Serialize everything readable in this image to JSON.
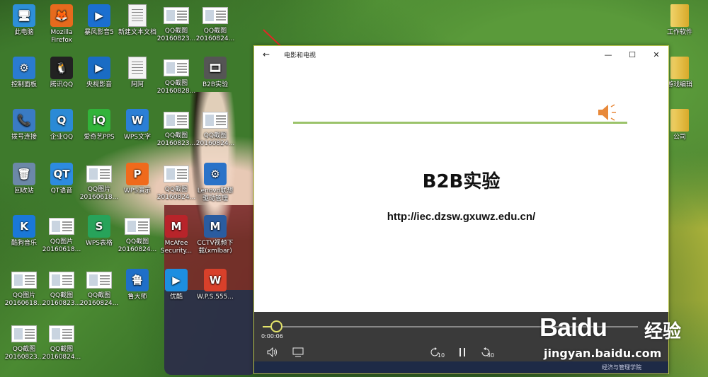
{
  "desktop": {
    "icons": [
      {
        "label": "此电脑",
        "kind": "ico",
        "color": "#2d8fd8",
        "glyph": "🖥"
      },
      {
        "label": "Mozilla Firefox",
        "kind": "ico",
        "color": "#e66a1d",
        "glyph": "🦊"
      },
      {
        "label": "暴风影音5",
        "kind": "ico",
        "color": "#1b6fd0",
        "glyph": "▶"
      },
      {
        "label": "新建文本文档",
        "kind": "doc"
      },
      {
        "label": "QQ截图 20160823...",
        "kind": "thumb"
      },
      {
        "label": "QQ截图 20160824...",
        "kind": "thumb"
      },
      {
        "label": "控制面板",
        "kind": "ico",
        "color": "#2a7bd0",
        "glyph": "⚙"
      },
      {
        "label": "腾讯QQ",
        "kind": "ico",
        "color": "#222222",
        "glyph": "🐧"
      },
      {
        "label": "央视影音",
        "kind": "ico",
        "color": "#1a6cc4",
        "glyph": "▶"
      },
      {
        "label": "阿阿",
        "kind": "doc"
      },
      {
        "label": "QQ截图 20160828...",
        "kind": "thumb"
      },
      {
        "label": "B2B实验",
        "kind": "ico",
        "color": "#555555",
        "glyph": "🎞"
      },
      {
        "label": "拨号连接",
        "kind": "ico",
        "color": "#3a7bc4",
        "glyph": "📞"
      },
      {
        "label": "企业QQ",
        "kind": "ico",
        "color": "#2b8ad6",
        "glyph": "Q"
      },
      {
        "label": "爱奇艺PPS",
        "kind": "ico",
        "color": "#32b33a",
        "glyph": "iQ"
      },
      {
        "label": "WPS文字",
        "kind": "ico",
        "color": "#2b7fd6",
        "glyph": "W"
      },
      {
        "label": "QQ截图 20160823...",
        "kind": "thumb"
      },
      {
        "label": "QQ截图 20160824...",
        "kind": "thumb"
      },
      {
        "label": "回收站",
        "kind": "ico",
        "color": "#6c88a8",
        "glyph": "🗑"
      },
      {
        "label": "QT语音",
        "kind": "ico",
        "color": "#2d8be0",
        "glyph": "QT"
      },
      {
        "label": "QQ图片 20160618...",
        "kind": "thumb"
      },
      {
        "label": "WPS演示",
        "kind": "ico",
        "color": "#f06a1c",
        "glyph": "P"
      },
      {
        "label": "QQ截图 20160824...",
        "kind": "thumb"
      },
      {
        "label": "Lenovo联想驱动管理",
        "kind": "ico",
        "color": "#2a72c8",
        "glyph": "⚙"
      },
      {
        "label": "酷狗音乐",
        "kind": "ico",
        "color": "#1a78d8",
        "glyph": "K"
      },
      {
        "label": "QQ图片 20160618...",
        "kind": "thumb"
      },
      {
        "label": "WPS表格",
        "kind": "ico",
        "color": "#27a35a",
        "glyph": "S"
      },
      {
        "label": "QQ截图 20160824...",
        "kind": "thumb"
      },
      {
        "label": "McAfee Security...",
        "kind": "ico",
        "color": "#b8242a",
        "glyph": "M"
      },
      {
        "label": "CCTV视频下载(xmlbar)",
        "kind": "ico",
        "color": "#2a5ca0",
        "glyph": "M"
      },
      {
        "label": "QQ图片 20160618...",
        "kind": "thumb"
      },
      {
        "label": "QQ截图 20160823...",
        "kind": "thumb"
      },
      {
        "label": "QQ截图 20160824...",
        "kind": "thumb"
      },
      {
        "label": "鲁大师",
        "kind": "ico",
        "color": "#1f6fc8",
        "glyph": "鲁"
      },
      {
        "label": "优酷",
        "kind": "ico",
        "color": "#1d8ee0",
        "glyph": "▶"
      },
      {
        "label": "W.P.S.555...",
        "kind": "ico",
        "color": "#d8402a",
        "glyph": "W"
      },
      {
        "label": "QQ截图 20160823...",
        "kind": "thumb"
      },
      {
        "label": "QQ截图 20160824...",
        "kind": "thumb"
      },
      {
        "label": "工作软件",
        "kind": "folder"
      },
      {
        "label": "游戏编辑",
        "kind": "folder"
      },
      {
        "label": "公司",
        "kind": "folder"
      }
    ]
  },
  "window": {
    "title": "电影和电视",
    "back_icon": "←",
    "minimize_icon": "—",
    "maximize_icon": "☐",
    "close_icon": "✕"
  },
  "slide": {
    "title": "B2B实验",
    "url": "http://iec.dzsw.gxuwz.edu.cn/"
  },
  "player": {
    "elapsed": "0:00:06",
    "progress_fraction": 0.02,
    "accent": "#e3e36a",
    "rewind_label": "10",
    "forward_label": "30",
    "bottom_text": "经济与管理学院"
  },
  "watermark": {
    "brand": "Bai",
    "brand_paw": "du",
    "cn": "经验",
    "url": "jingyan.baidu.com"
  }
}
